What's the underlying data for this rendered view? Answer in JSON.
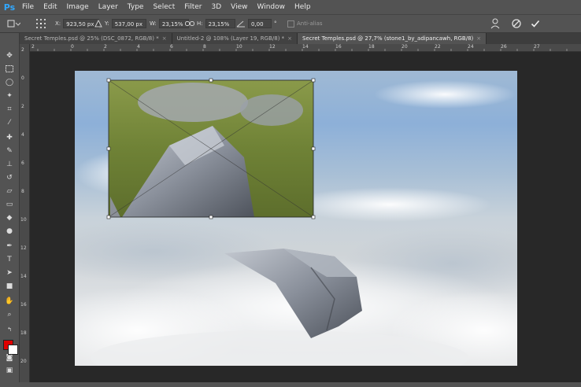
{
  "app": {
    "logo": "Ps"
  },
  "menu": [
    "File",
    "Edit",
    "Image",
    "Layer",
    "Type",
    "Select",
    "Filter",
    "3D",
    "View",
    "Window",
    "Help"
  ],
  "options": {
    "x_label": "X:",
    "x_value": "923,50 px",
    "y_label": "Y:",
    "y_value": "537,00 px",
    "w_label": "W:",
    "w_value": "23,15%",
    "h_label": "H:",
    "h_value": "23,15%",
    "angle_value": "0,00",
    "angle_unit": "°",
    "antialias_label": "Anti-alias",
    "cancel_icon": "cancel-icon",
    "commit_icon": "commit-icon"
  },
  "tabs": [
    {
      "label": "Secret Temples.psd @ 25% (DSC_0872, RGB/8) *",
      "active": false
    },
    {
      "label": "Untitled-2 @ 108% (Layer 19, RGB/8) *",
      "active": false
    },
    {
      "label": "Secret Temples.psd @ 27,7% (stone1_by_adipancawh, RGB/8)",
      "active": true
    }
  ],
  "ruler_h_labels": [
    "2",
    "0",
    "2",
    "4",
    "6",
    "8",
    "10",
    "12",
    "14",
    "16",
    "18",
    "20",
    "22",
    "24",
    "26",
    "27"
  ],
  "ruler_v_labels": [
    "2",
    "0",
    "2",
    "4",
    "6",
    "8",
    "10",
    "12",
    "14",
    "16",
    "18",
    "20"
  ],
  "colors": {
    "foreground": "#e00000",
    "background": "#ffffff",
    "accent": "#31a8ff"
  }
}
